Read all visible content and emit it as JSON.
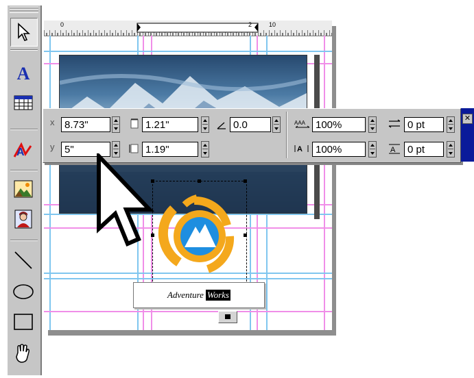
{
  "toolbox": {
    "tools": [
      {
        "name": "selection-tool",
        "icon": "arrow-pointer-icon",
        "active": true
      },
      {
        "name": "type-tool",
        "icon": "type-a-icon",
        "glyph": "A"
      },
      {
        "name": "table-tool",
        "icon": "table-grid-icon"
      },
      {
        "name": "text-path-tool",
        "icon": "text-on-path-icon"
      },
      {
        "name": "picture-box-tool",
        "icon": "picture-landscape-icon"
      },
      {
        "name": "portrait-tool",
        "icon": "portrait-person-icon"
      },
      {
        "name": "line-tool",
        "icon": "diagonal-line-icon"
      },
      {
        "name": "oval-tool",
        "icon": "ellipse-icon"
      },
      {
        "name": "rectangle-tool",
        "icon": "rectangle-icon"
      },
      {
        "name": "pan-tool",
        "icon": "grabber-hand-icon"
      }
    ]
  },
  "ruler": {
    "marks": [
      "0",
      "2",
      "10"
    ]
  },
  "measurements": {
    "x_label": "x",
    "x_value": "8.73\"",
    "y_label": "y",
    "y_value": "5\"",
    "width_value": "1.21\"",
    "height_value": "1.19\"",
    "angle_value": "0.0",
    "h_scale_value": "100%",
    "v_scale_value": "100%",
    "kerning_value": "0 pt",
    "leading_value": "0 pt",
    "close_glyph": "✕"
  },
  "caption": {
    "text": "Adventure",
    "inverted": "Works"
  },
  "colors": {
    "logo_orange": "#f4a81c",
    "logo_blue": "#1e8ee0",
    "guide_cyan": "#7fc6ef",
    "guide_pink": "#f08ee8",
    "palette_gray": "#c6c6c6",
    "close_blue": "#0a1a9a"
  }
}
